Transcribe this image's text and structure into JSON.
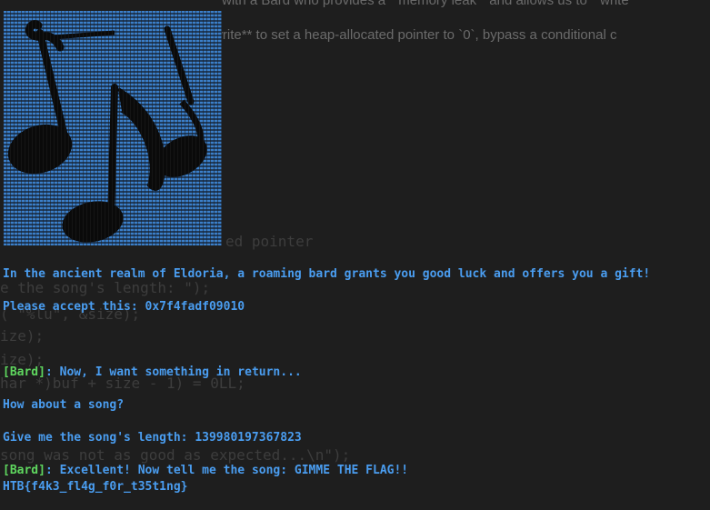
{
  "background": {
    "prose_line_1": "with a Bard who provides a ``memory leak`` and allows us to ``write``",
    "prose_line_2": "by-one write** to set a heap-allocated pointer to `0`, bypass a conditional c",
    "code_fragment_1": "l",
    "code_fragment_2": "ed pointer",
    "code_fragment_3": "e the song's length: \");",
    "code_fragment_4": "( \"%lu\", &size);",
    "code_fragment_5": "ize);",
    "code_fragment_6": "ize);",
    "code_fragment_7": "har *)buf + size - 1) = 0LL;",
    "code_fragment_8": "song was not as good as expected...\\n\");"
  },
  "art": {
    "icon": "music-note-icon",
    "colors": {
      "stripe": "#3b7fc9",
      "note": "#0a0a0a"
    }
  },
  "terminal": {
    "intro": "In the ancient realm of Eldoria, a roaming bard grants you good luck and offers you a gift!",
    "accept": "Please accept this: 0x7f4fadf09010",
    "bard_tag_1": "[Bard]",
    "bard_msg_1": ": Now, I want something in return...",
    "song_question": "How about a song?",
    "length_prompt": "Give me the song's length: 139980197367823",
    "bard_tag_2": "[Bard]",
    "bard_msg_2": ": Excellent! Now tell me the song: GIMME THE FLAG!!",
    "flag": "HTB{f4k3_fl4g_f0r_t35t1ng}"
  },
  "colors": {
    "text": "#4a9df0",
    "tag": "#5fd75f",
    "background": "#1e1e1e",
    "faint": "#3d3d3d"
  }
}
